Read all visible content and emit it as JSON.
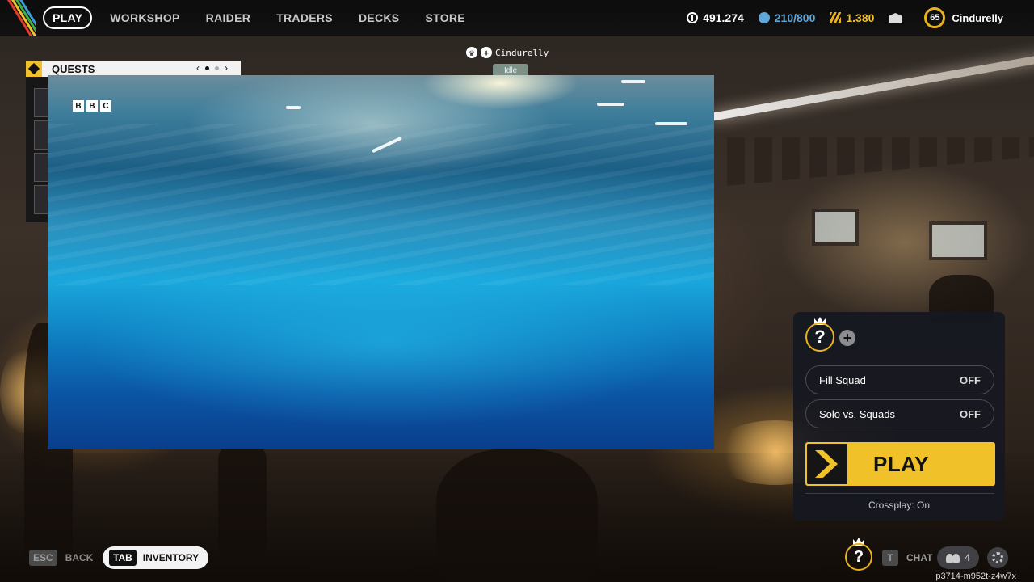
{
  "nav": {
    "items": [
      "PLAY",
      "WORKSHOP",
      "RAIDER",
      "TRADERS",
      "DECKS",
      "STORE"
    ],
    "active": "PLAY"
  },
  "currencies": {
    "credits": "491.274",
    "blue_token": "210/800",
    "gold": "1.380"
  },
  "player": {
    "level": "65",
    "name": "Cindurelly"
  },
  "quests": {
    "title": "QUESTS",
    "prev": "‹",
    "next": "›",
    "page": 1,
    "pages": 2
  },
  "party_tag": {
    "name": "Cindurelly",
    "status": "Idle"
  },
  "video": {
    "logo_letters": [
      "B",
      "B",
      "C"
    ]
  },
  "squad": {
    "slot_mark": "?",
    "fill_squad": {
      "label": "Fill Squad",
      "value": "OFF"
    },
    "solo_vs_squads": {
      "label": "Solo vs. Squads",
      "value": "OFF"
    },
    "play_label": "PLAY",
    "crossplay": "Crossplay: On"
  },
  "bottom": {
    "back_key": "ESC",
    "back_label": "BACK",
    "inventory_key": "TAB",
    "inventory_label": "INVENTORY",
    "avatar_mark": "?",
    "chat_key": "T",
    "chat_label": "CHAT",
    "friends_count": "4",
    "build_id": "p3714-m952t-z4w7x"
  },
  "colors": {
    "accent": "#f1c12a",
    "panel": "#16181f",
    "blue_token": "#5fa7d8"
  }
}
